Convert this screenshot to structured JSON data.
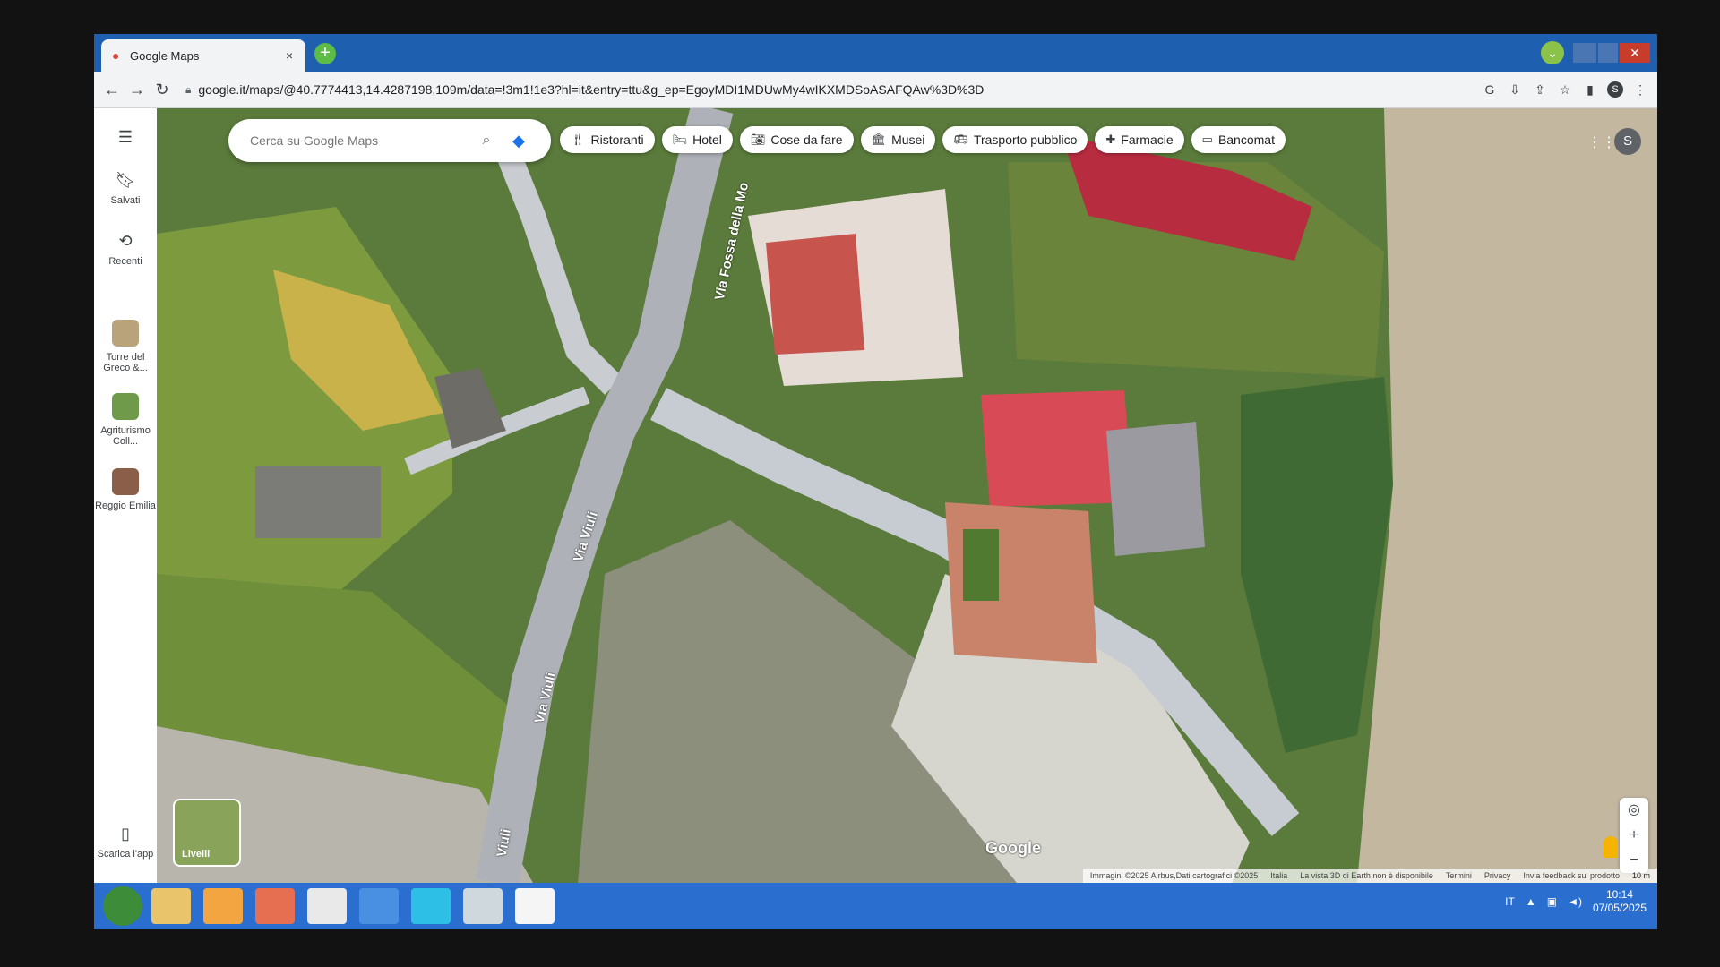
{
  "browser": {
    "tab_title": "Google Maps",
    "url": "google.it/maps/@40.7774413,14.4287198,109m/data=!3m1!1e3?hl=it&entry=ttu&g_ep=EgoyMDI1MDUwMy4wIKXMDSoASAFQAw%3D%3D",
    "profile_initial": "S"
  },
  "maps": {
    "search_placeholder": "Cerca su Google Maps",
    "sidebar": {
      "saved": "Salvati",
      "recent": "Recenti",
      "recent_places": [
        {
          "label": "Torre del Greco &..."
        },
        {
          "label": "Agriturismo Coll..."
        },
        {
          "label": "Reggio Emilia"
        }
      ],
      "download_app": "Scarica l'app"
    },
    "chips": [
      {
        "label": "Ristoranti",
        "icon": "fork-knife-icon"
      },
      {
        "label": "Hotel",
        "icon": "bed-icon"
      },
      {
        "label": "Cose da fare",
        "icon": "camera-icon"
      },
      {
        "label": "Musei",
        "icon": "museum-icon"
      },
      {
        "label": "Trasporto pubblico",
        "icon": "bus-icon"
      },
      {
        "label": "Farmacie",
        "icon": "pharmacy-icon"
      },
      {
        "label": "Bancomat",
        "icon": "atm-icon"
      }
    ],
    "street_labels": {
      "via_fossa": "Via Fossa della Mo",
      "via_viuli": "Via Viuli",
      "via_viuli_2": "Via Viuli",
      "viuli_short": "Viuli"
    },
    "layers_label": "Livelli",
    "google_logo": "Google",
    "attribution": {
      "imagery": "Immagini ©2025 Airbus,Dati cartografici ©2025",
      "italy": "Italia",
      "notice": "La vista 3D di Earth non è disponibile",
      "terms": "Termini",
      "privacy": "Privacy",
      "feedback": "Invia feedback sul prodotto",
      "scale": "10 m"
    },
    "avatar_initial": "S"
  },
  "taskbar": {
    "language": "IT",
    "time": "10:14",
    "date": "07/05/2025"
  },
  "colors": {
    "accent": "#1a73e8",
    "taskbar": "#2a6fd0",
    "tabstrip": "#1f5fb0"
  }
}
